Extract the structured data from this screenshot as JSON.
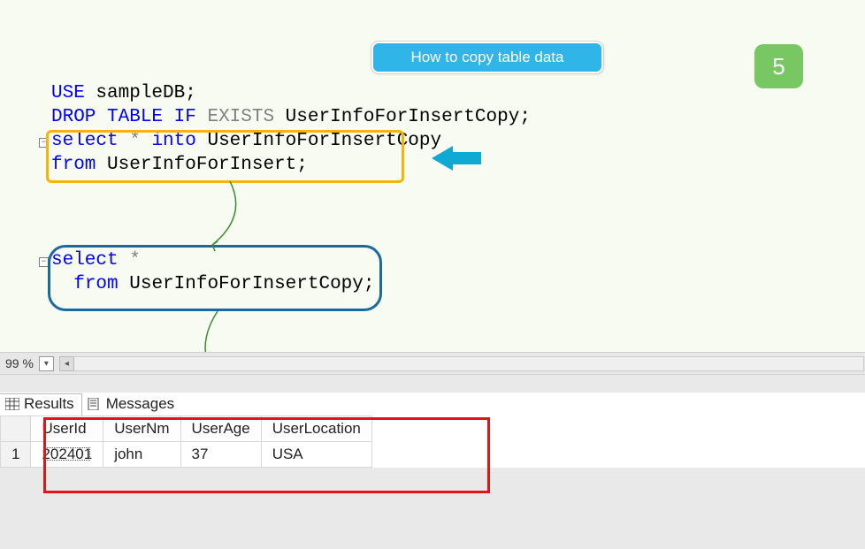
{
  "callout": {
    "text": "How to copy table data"
  },
  "badge": {
    "value": "5"
  },
  "code": {
    "line1_use": "USE",
    "line1_db": " sampleDB",
    "line1_semi": ";",
    "line2_drop": "DROP",
    "line2_table": " TABLE",
    "line2_if": " IF",
    "line2_exists": " EXISTS",
    "line2_name": " UserInfoForInsertCopy",
    "line2_semi": ";",
    "line3_select": "select",
    "line3_star": " *",
    "line3_into": " into",
    "line3_target": " UserInfoForInsertCopy",
    "line4_from": "from",
    "line4_src": " UserInfoForInsert",
    "line4_semi": ";",
    "line6_select": "select",
    "line6_star": " *",
    "line7_from": "from",
    "line7_src": " UserInfoForInsertCopy",
    "line7_semi": ";"
  },
  "zoom": {
    "value": "99 %"
  },
  "tabs": {
    "results": "Results",
    "messages": "Messages"
  },
  "grid": {
    "columns": [
      "UserId",
      "UserNm",
      "UserAge",
      "UserLocation"
    ],
    "rownum": "1",
    "row1": {
      "UserId": "202401",
      "UserNm": "john",
      "UserAge": "37",
      "UserLocation": "USA"
    }
  }
}
